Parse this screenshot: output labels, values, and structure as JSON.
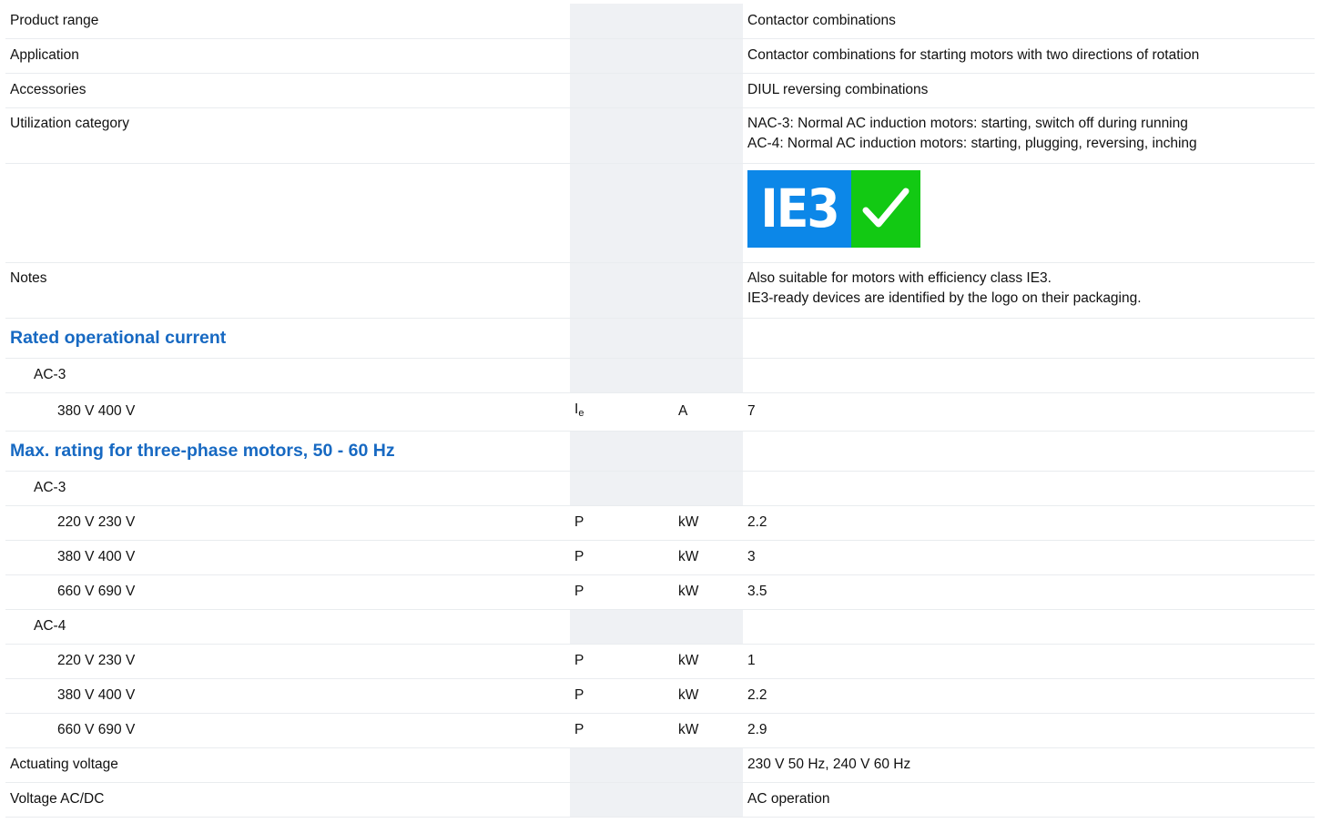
{
  "rows": {
    "product_range": {
      "label": "Product range",
      "value": "Contactor combinations"
    },
    "application": {
      "label": "Application",
      "value": "Contactor combinations for starting motors with two directions of rotation"
    },
    "accessories": {
      "label": "Accessories",
      "value": "DIUL reversing combinations"
    },
    "utilization": {
      "label": "Utilization category",
      "value_line1": "NAC-3: Normal AC induction motors: starting, switch off during running",
      "value_line2": "AC-4: Normal AC induction motors: starting, plugging, reversing, inching"
    },
    "logo": {
      "text": "IE3",
      "icon": "checkmark-icon",
      "blue": "#0c87e8",
      "green": "#12c913"
    },
    "notes": {
      "label": "Notes",
      "value_line1": "Also suitable for motors with efficiency class IE3.",
      "value_line2": "IE3-ready devices are identified by the logo on their packaging."
    },
    "rated_current": {
      "heading": "Rated operational current",
      "ac3": "AC-3",
      "v400": {
        "label": "380 V 400 V",
        "symbol": "I",
        "symbol_sub": "e",
        "unit": "A",
        "value": "7"
      }
    },
    "max_rating": {
      "heading": "Max. rating for three-phase motors, 50 - 60 Hz",
      "ac3": "AC-3",
      "ac3_rows": [
        {
          "label": "220 V 230 V",
          "symbol": "P",
          "unit": "kW",
          "value": "2.2"
        },
        {
          "label": "380 V 400 V",
          "symbol": "P",
          "unit": "kW",
          "value": "3"
        },
        {
          "label": "660 V 690 V",
          "symbol": "P",
          "unit": "kW",
          "value": "3.5"
        }
      ],
      "ac4": "AC-4",
      "ac4_rows": [
        {
          "label": "220 V 230 V",
          "symbol": "P",
          "unit": "kW",
          "value": "1"
        },
        {
          "label": "380 V 400 V",
          "symbol": "P",
          "unit": "kW",
          "value": "2.2"
        },
        {
          "label": "660 V 690 V",
          "symbol": "P",
          "unit": "kW",
          "value": "2.9"
        }
      ]
    },
    "actuating_voltage": {
      "label": "Actuating voltage",
      "value": "230 V 50 Hz, 240 V 60 Hz"
    },
    "voltage_acdc": {
      "label": "Voltage AC/DC",
      "value": "AC operation"
    }
  },
  "colors": {
    "heading": "#1769c2",
    "shade": "#eff1f4",
    "divider": "#e9ecef"
  }
}
